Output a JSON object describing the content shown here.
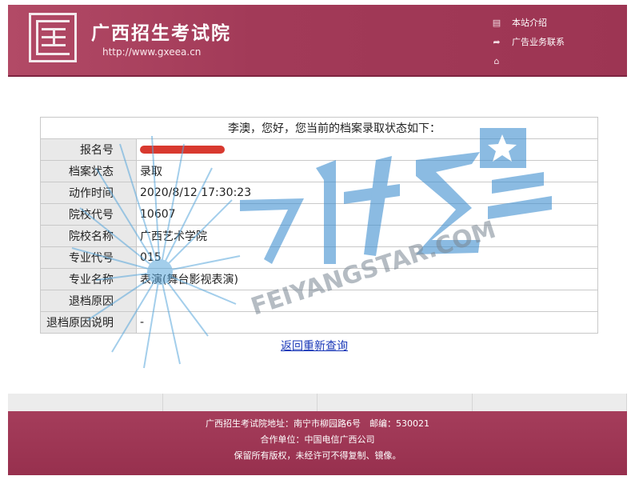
{
  "header": {
    "site_title": "广西招生考试院",
    "site_url": "http://www.gxeea.cn",
    "nav": [
      {
        "label": "本站介绍",
        "icon": "document-icon"
      },
      {
        "label": "广告业务联系",
        "icon": "share-icon"
      },
      {
        "label": "",
        "icon": "home-icon"
      }
    ]
  },
  "status": {
    "greeting": "李澳，您好，您当前的档案录取状态如下：",
    "rows": [
      {
        "key": "报名号",
        "value": ""
      },
      {
        "key": "档案状态",
        "value": "录取"
      },
      {
        "key": "动作时间",
        "value": "2020/8/12 17:30:23"
      },
      {
        "key": "院校代号",
        "value": "10607"
      },
      {
        "key": "院校名称",
        "value": "广西艺术学院"
      },
      {
        "key": "专业代号",
        "value": "015"
      },
      {
        "key": "专业名称",
        "value": "表演(舞台影视表演)"
      },
      {
        "key": "退档原因",
        "value": ""
      },
      {
        "key": "退档原因说明",
        "value": "-"
      }
    ],
    "back_link": "返回重新查询"
  },
  "footer": {
    "line1": "广西招生考试院地址：南宁市柳园路6号　邮编：530021",
    "line2": "合作单位：中国电信广西公司",
    "line3": "保留所有版权，未经许可不得复制、镜像。"
  },
  "watermark": {
    "text": "FEIYANGSTAR.COM",
    "color": "#3f8fd0"
  },
  "colors": {
    "brand": "#a23a58",
    "link": "#1a38b8"
  }
}
